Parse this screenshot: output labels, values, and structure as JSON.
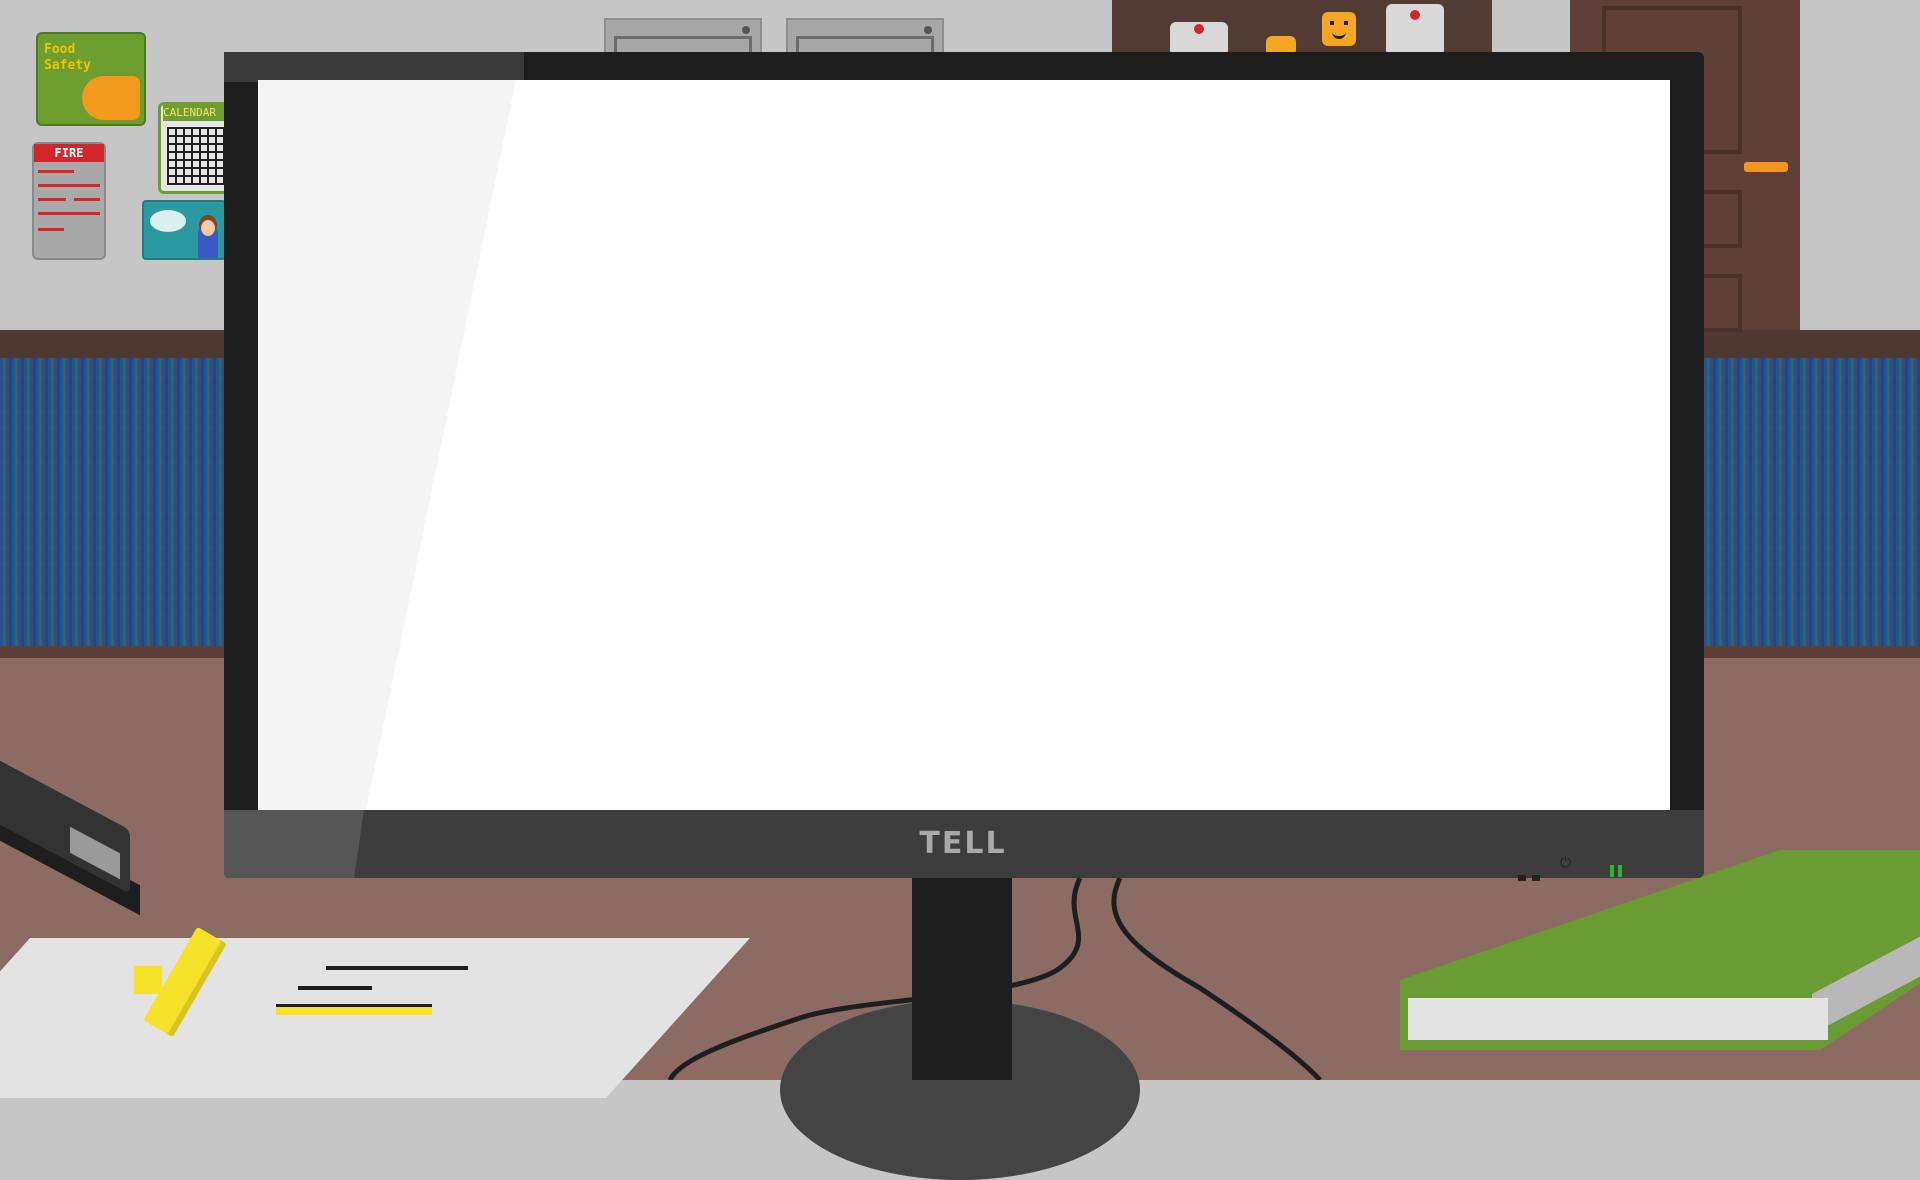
{
  "wall": {
    "food_poster": {
      "title": "Food",
      "subtitle": "Safety"
    },
    "calendar": {
      "title": "CALENDAR"
    },
    "fire_poster": {
      "title": "FIRE"
    }
  },
  "monitor": {
    "brand": "TELL",
    "power_symbol": "⏻",
    "screen_state": "blank-white"
  },
  "colors": {
    "wall": "#c6c6c6",
    "wallpaper": "#3a5780",
    "desk": "#8b6b62",
    "door": "#5e4036",
    "monitor_bezel": "#1e1e1e",
    "screen": "#ffffff",
    "book_cover": "#6a9c33",
    "highlighter": "#f5e12a",
    "power_led": "#2fb52f",
    "fire_red": "#d3262a"
  },
  "icons": [
    "smiley-face-icon",
    "power-icon",
    "red-pushpin-icon"
  ]
}
